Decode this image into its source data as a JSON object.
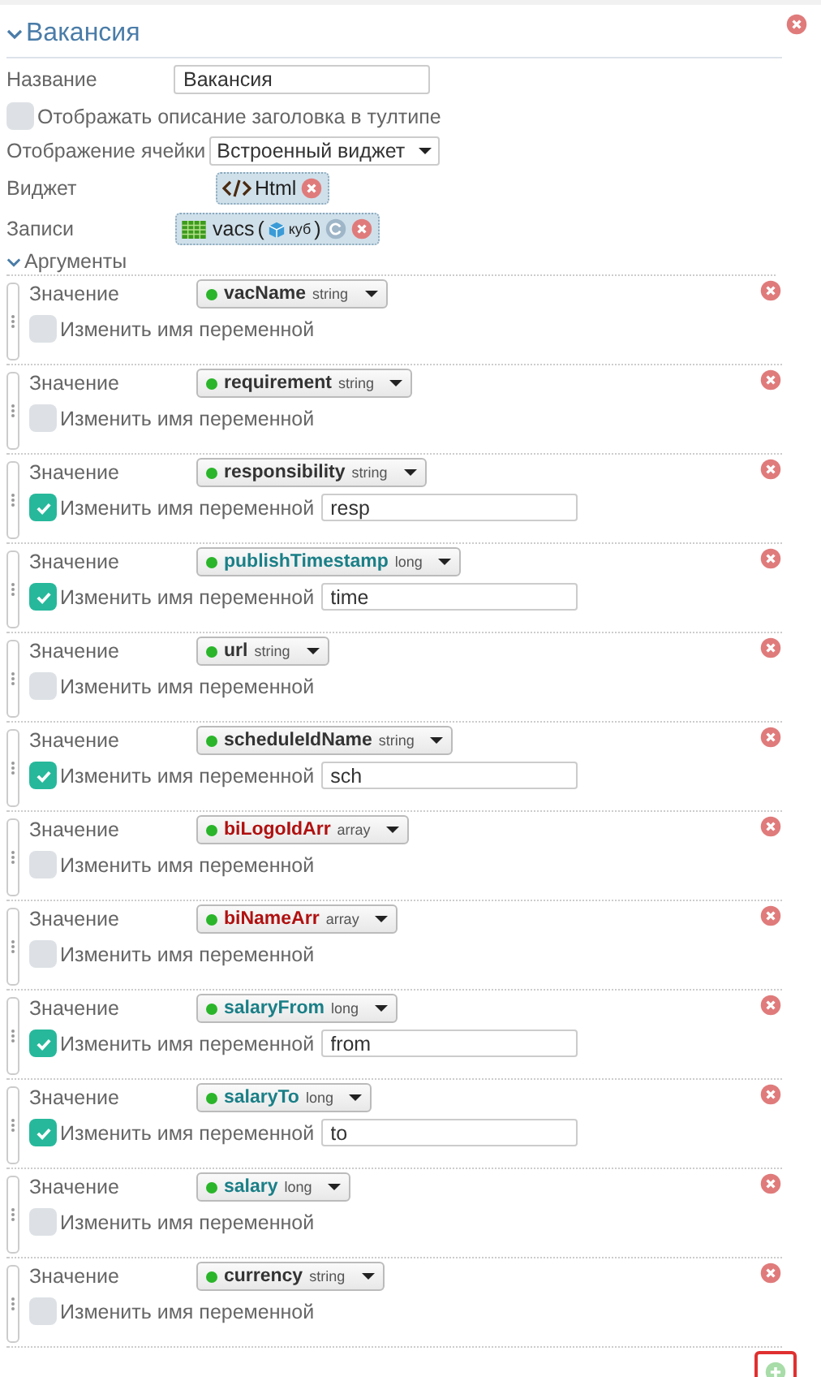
{
  "section": {
    "title": "Вакансия",
    "expanded": true
  },
  "fields": {
    "name_label": "Название",
    "name_value": "Вакансия",
    "tooltip_label": "Отображать описание заголовка в тултипе",
    "tooltip_checked": false,
    "cell_label": "Отображение ячейки",
    "cell_value": "Встроенный виджет",
    "widget_label": "Виджет",
    "widget_value": "Html",
    "records_label": "Записи",
    "records_value": "vacs",
    "records_open": "(",
    "records_source": "куб",
    "records_close": ")"
  },
  "arguments": {
    "title": "Аргументы",
    "expanded": true,
    "items": [
      {
        "label": "Значение",
        "variable": "vacName",
        "type": "string",
        "color": "#333333",
        "rename_label": "Изменить имя переменной",
        "rename": false
      },
      {
        "label": "Значение",
        "variable": "requirement",
        "type": "string",
        "color": "#333333",
        "rename_label": "Изменить имя переменной",
        "rename": false
      },
      {
        "label": "Значение",
        "variable": "responsibility",
        "type": "string",
        "color": "#333333",
        "rename_label": "Изменить имя переменной",
        "rename": true,
        "new_name": "resp"
      },
      {
        "label": "Значение",
        "variable": "publishTimestamp",
        "type": "long",
        "color": "#1a7f87",
        "rename_label": "Изменить имя переменной",
        "rename": true,
        "new_name": "time"
      },
      {
        "label": "Значение",
        "variable": "url",
        "type": "string",
        "color": "#333333",
        "rename_label": "Изменить имя переменной",
        "rename": false
      },
      {
        "label": "Значение",
        "variable": "scheduleIdName",
        "type": "string",
        "color": "#333333",
        "rename_label": "Изменить имя переменной",
        "rename": true,
        "new_name": "sch"
      },
      {
        "label": "Значение",
        "variable": "biLogoIdArr",
        "type": "array",
        "color": "#b01010",
        "rename_label": "Изменить имя переменной",
        "rename": false
      },
      {
        "label": "Значение",
        "variable": "biNameArr",
        "type": "array",
        "color": "#b01010",
        "rename_label": "Изменить имя переменной",
        "rename": false
      },
      {
        "label": "Значение",
        "variable": "salaryFrom",
        "type": "long",
        "color": "#1a7f87",
        "rename_label": "Изменить имя переменной",
        "rename": true,
        "new_name": "from"
      },
      {
        "label": "Значение",
        "variable": "salaryTo",
        "type": "long",
        "color": "#1a7f87",
        "rename_label": "Изменить имя переменной",
        "rename": true,
        "new_name": "to"
      },
      {
        "label": "Значение",
        "variable": "salary",
        "type": "long",
        "color": "#1a7f87",
        "rename_label": "Изменить имя переменной",
        "rename": false
      },
      {
        "label": "Значение",
        "variable": "currency",
        "type": "string",
        "color": "#333333",
        "rename_label": "Изменить имя переменной",
        "rename": false
      }
    ]
  }
}
